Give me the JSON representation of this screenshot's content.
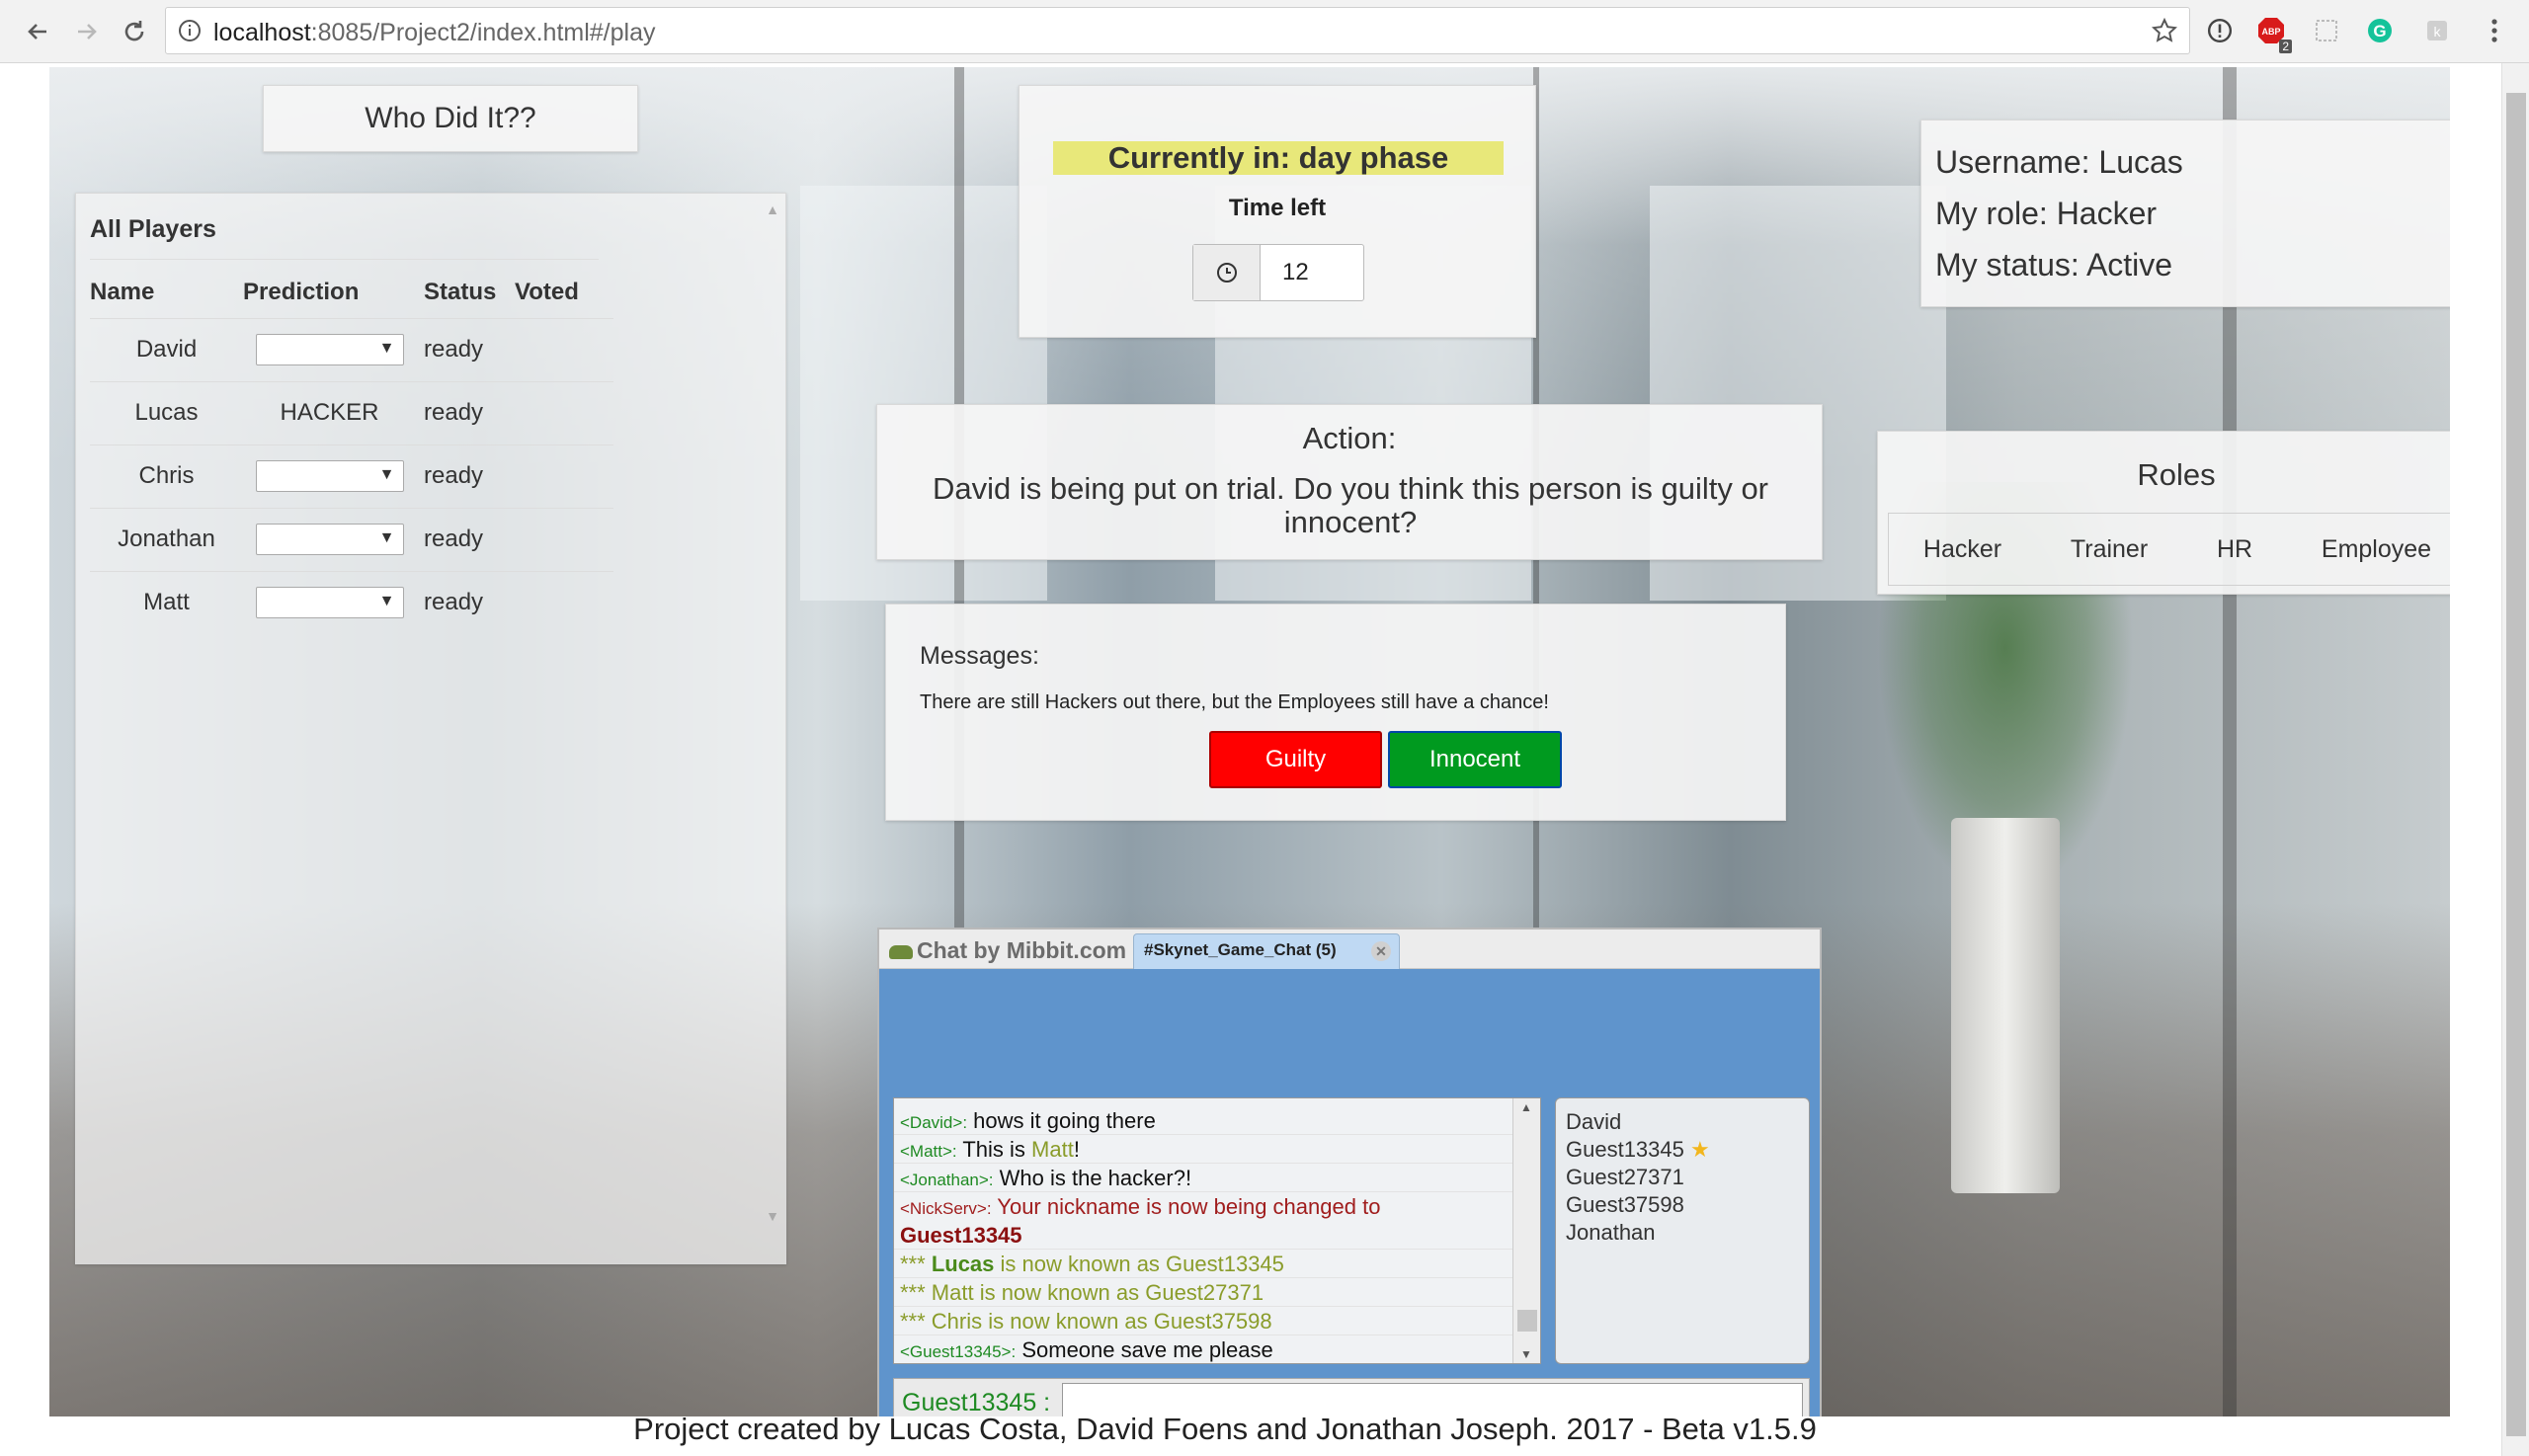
{
  "browser": {
    "url_host": "localhost",
    "url_path": ":8085/Project2/index.html#/play",
    "extensions": [
      "info-icon",
      "adblock-icon",
      "extension-icon",
      "grammarly-icon",
      "extension-2-icon"
    ],
    "adblock_count": "2"
  },
  "app": {
    "title": "Who Did It??"
  },
  "players": {
    "header": "All Players",
    "columns": [
      "Name",
      "Prediction",
      "Status",
      "Voted"
    ],
    "rows": [
      {
        "name": "David",
        "prediction": "",
        "status": "ready",
        "voted": ""
      },
      {
        "name": "Lucas",
        "prediction": "HACKER",
        "status": "ready",
        "voted": ""
      },
      {
        "name": "Chris",
        "prediction": "",
        "status": "ready",
        "voted": ""
      },
      {
        "name": "Jonathan",
        "prediction": "",
        "status": "ready",
        "voted": ""
      },
      {
        "name": "Matt",
        "prediction": "",
        "status": "ready",
        "voted": ""
      }
    ]
  },
  "phase": {
    "banner": "Currently in: day phase",
    "time_label": "Time left",
    "time_value": "12",
    "banner_color": "#e8e87a"
  },
  "user": {
    "username": "Username: Lucas",
    "role": "My role: Hacker",
    "status": "My status: Active"
  },
  "action": {
    "label": "Action:",
    "text": "David is being put on trial. Do you think this person is guilty or innocent?"
  },
  "roles": {
    "label": "Roles",
    "items": [
      "Hacker",
      "Trainer",
      "HR",
      "Employee"
    ]
  },
  "messages": {
    "label": "Messages:",
    "text": "There are still Hackers out there, but the Employees still have a chance!",
    "guilty_label": "Guilty",
    "innocent_label": "Innocent",
    "guilty_color": "#ff0000",
    "innocent_color": "#009a1f"
  },
  "chat": {
    "brand": "Chat by Mibbit.com",
    "tab_label": "#Skynet_Game_Chat (5)",
    "log": {
      "l1_nick": "<David>:",
      "l1_msg": " hows it going there",
      "l2_nick": "<Matt>:",
      "l2_msg": " This is ",
      "l2_link": "Matt",
      "l2_end": "!",
      "l3_nick": "<Jonathan>:",
      "l3_msg": " Who is the hacker?!",
      "l4_nick": "<NickServ>:",
      "l4_msg": " Your nickname is now being changed to",
      "l5_msg": "Guest13345",
      "l6_stars": "***",
      "l6_name": "Lucas",
      "l6_msg": " is now known as Guest13345",
      "l7_msg": "*** Matt is now known as Guest27371",
      "l8_msg": "*** Chris is now known as Guest37598",
      "l9_nick": "<Guest13345>:",
      "l9_msg": " Someone save me please"
    },
    "users": [
      "David",
      "Guest13345",
      "Guest27371",
      "Guest37598",
      "Jonathan"
    ],
    "input_nick": "Guest13345 :",
    "background_color": "#5f94cc"
  },
  "footer": "Project created by Lucas Costa, David Foens and Jonathan Joseph. 2017 - Beta v1.5.9"
}
